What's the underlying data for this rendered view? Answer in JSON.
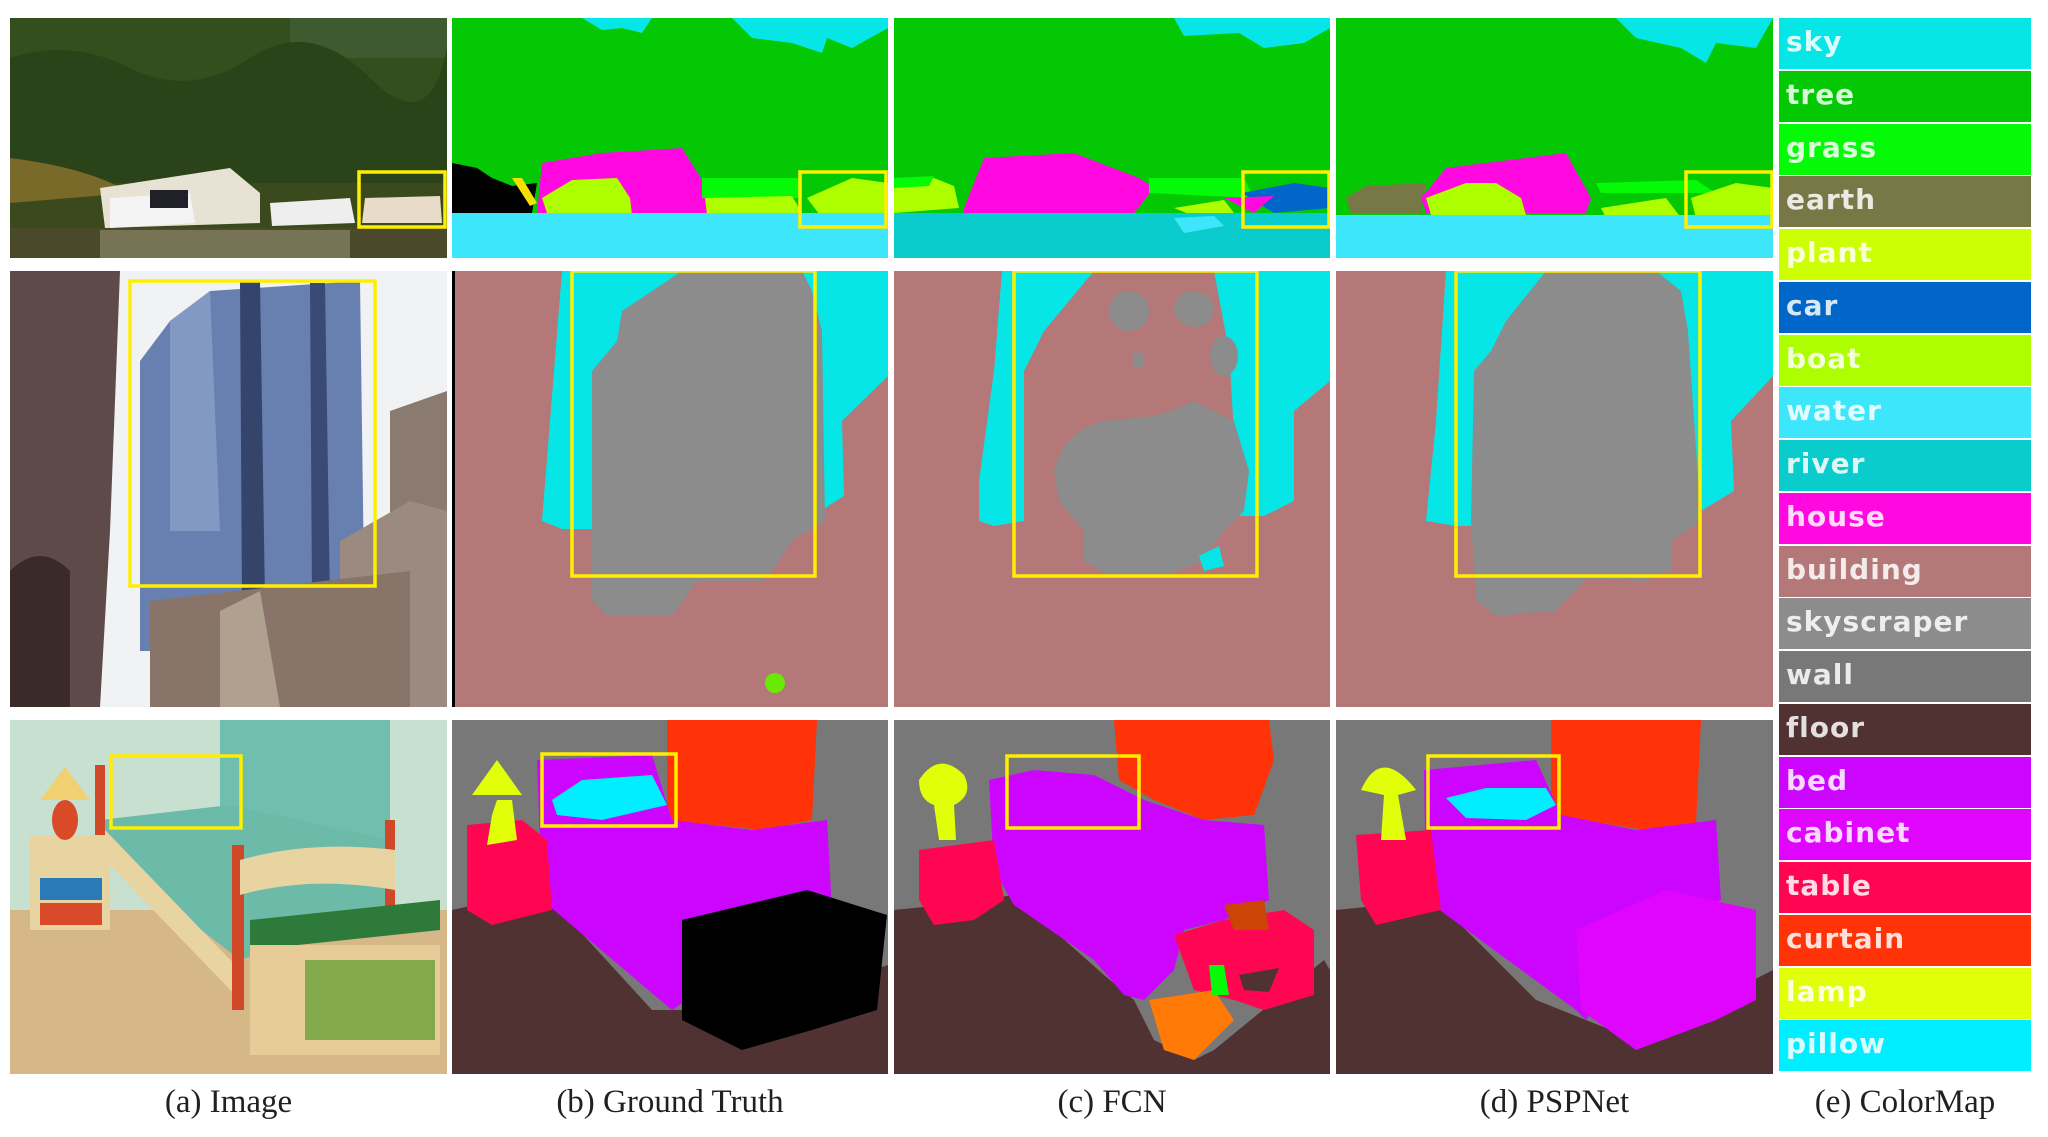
{
  "figure": {
    "columns": [
      {
        "id": "a",
        "caption": "(a) Image"
      },
      {
        "id": "b",
        "caption": "(b) Ground Truth"
      },
      {
        "id": "c",
        "caption": "(c) FCN"
      },
      {
        "id": "d",
        "caption": "(d) PSPNet"
      },
      {
        "id": "e",
        "caption": "(e) ColorMap"
      }
    ],
    "rows": [
      {
        "scene": "lake with boathouse and boats",
        "highlight": "boat"
      },
      {
        "scene": "skyscraper among buildings",
        "highlight": "skyscraper"
      },
      {
        "scene": "bedroom with bed, lamp, nightstand",
        "highlight": "pillow"
      }
    ],
    "highlight_color": "#ffee00"
  },
  "colormap": [
    {
      "label": "sky",
      "color": "#06e6e6"
    },
    {
      "label": "tree",
      "color": "#04c804"
    },
    {
      "label": "grass",
      "color": "#04fa07"
    },
    {
      "label": "earth",
      "color": "#787846"
    },
    {
      "label": "plant",
      "color": "#ccff04"
    },
    {
      "label": "car",
      "color": "#0066c8"
    },
    {
      "label": "boat",
      "color": "#adff00"
    },
    {
      "label": "water",
      "color": "#3de6fa"
    },
    {
      "label": "river",
      "color": "#0acccc"
    },
    {
      "label": "house",
      "color": "#ff09e0"
    },
    {
      "label": "building",
      "color": "#b47878"
    },
    {
      "label": "skyscraper",
      "color": "#8c8c8c"
    },
    {
      "label": "wall",
      "color": "#787878"
    },
    {
      "label": "floor",
      "color": "#503232"
    },
    {
      "label": "bed",
      "color": "#cc05ff"
    },
    {
      "label": "cabinet",
      "color": "#e005ff"
    },
    {
      "label": "table",
      "color": "#ff0652"
    },
    {
      "label": "curtain",
      "color": "#ff3307"
    },
    {
      "label": "lamp",
      "color": "#e0ff08"
    },
    {
      "label": "pillow",
      "color": "#00eeff"
    }
  ]
}
